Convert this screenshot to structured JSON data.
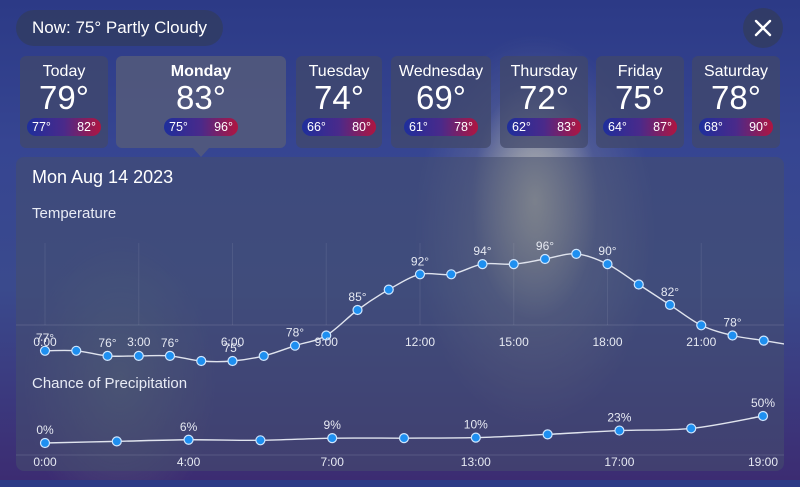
{
  "now": {
    "text": "Now: 75° Partly Cloudy"
  },
  "close_icon": "close-icon",
  "days": [
    {
      "name": "Today",
      "temp": "79°",
      "low": "77°",
      "high": "82°",
      "selected": false
    },
    {
      "name": "Monday",
      "temp": "83°",
      "low": "75°",
      "high": "96°",
      "selected": true
    },
    {
      "name": "Tuesday",
      "temp": "74°",
      "low": "66°",
      "high": "80°",
      "selected": false
    },
    {
      "name": "Wednesday",
      "temp": "69°",
      "low": "61°",
      "high": "78°",
      "selected": false
    },
    {
      "name": "Thursday",
      "temp": "72°",
      "low": "62°",
      "high": "83°",
      "selected": false
    },
    {
      "name": "Friday",
      "temp": "75°",
      "low": "64°",
      "high": "87°",
      "selected": false
    },
    {
      "name": "Saturday",
      "temp": "78°",
      "low": "68°",
      "high": "90°",
      "selected": false
    }
  ],
  "detail": {
    "date": "Mon Aug 14 2023",
    "temperature_label": "Temperature",
    "precip_label": "Chance of Precipitation"
  },
  "colors": {
    "point": "#1e8ff0",
    "line": "#e0e4ee",
    "range_low": "#1e2e9c",
    "range_high": "#b01540"
  },
  "chart_data": [
    {
      "type": "line",
      "name": "temperature",
      "x": [
        0,
        1,
        2,
        3,
        4,
        5,
        6,
        7,
        8,
        9,
        10,
        11,
        12,
        13,
        14,
        15,
        16,
        17,
        18,
        19,
        20,
        21,
        22,
        23
      ],
      "values": [
        77,
        77,
        76,
        76,
        76,
        75,
        75,
        76,
        78,
        80,
        85,
        89,
        92,
        92,
        94,
        94,
        95,
        96,
        94,
        90,
        86,
        82,
        80,
        79,
        78,
        77
      ],
      "point_labels": [
        "77°",
        "",
        "76°",
        "",
        "76°",
        "",
        "75°",
        "",
        "78°",
        "",
        "85°",
        "",
        "92°",
        "",
        "94°",
        "",
        "96°",
        "",
        "90°",
        "",
        "82°",
        "",
        "78°",
        ""
      ],
      "xticks": [
        "0:00",
        "3:00",
        "6:00",
        "9:00",
        "12:00",
        "15:00",
        "18:00",
        "21:00"
      ],
      "xtick_hours": [
        0,
        3,
        6,
        9,
        12,
        15,
        18,
        21
      ],
      "ylim": [
        70,
        100
      ]
    },
    {
      "type": "line",
      "name": "precipitation",
      "x": [
        0,
        2,
        4,
        6,
        7,
        9,
        13,
        15,
        17,
        19,
        21
      ],
      "values": [
        0,
        3,
        6,
        5,
        9,
        9,
        10,
        16,
        23,
        27,
        50
      ],
      "point_labels": [
        "0%",
        "",
        "6%",
        "",
        "9%",
        "",
        "10%",
        "",
        "23%",
        "",
        "50%"
      ],
      "xticks": [
        "0:00",
        "4:00",
        "7:00",
        "13:00",
        "17:00",
        "19:00"
      ],
      "ylim": [
        0,
        80
      ]
    }
  ]
}
